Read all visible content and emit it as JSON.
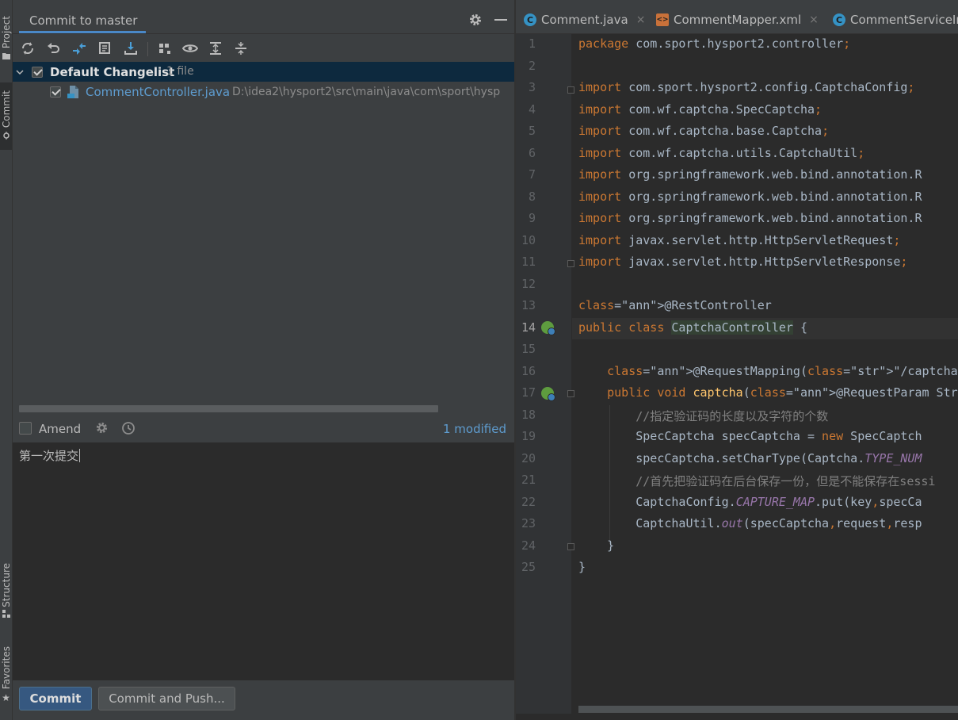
{
  "tool_strip": {
    "project_label": "Project",
    "commit_label": "Commit",
    "structure_label": "Structure",
    "favorites_label": "Favorites"
  },
  "panel": {
    "title": "Commit to master",
    "toolbar_icons": [
      "refresh-icon",
      "rollback-icon",
      "diff-icon",
      "show-history-icon",
      "update-icon",
      "group-by-icon",
      "eye-icon",
      "expand-all-icon",
      "collapse-all-icon"
    ],
    "changelist": {
      "name": "Default Changelist",
      "count": "1 file",
      "checked": true
    },
    "files": [
      {
        "name": "CommentController.java",
        "path": "D:\\idea2\\hysport2\\src\\main\\java\\com\\sport\\hysp",
        "checked": true
      }
    ],
    "amend_label": "Amend",
    "modified_label": "1 modified",
    "commit_message": "第一次提交",
    "commit_button": "Commit",
    "commit_push_button": "Commit and Push..."
  },
  "editor": {
    "tabs": [
      {
        "label": "Comment.java",
        "icon": "class-icon"
      },
      {
        "label": "CommentMapper.xml",
        "icon": "xml-icon"
      },
      {
        "label": "CommentServiceIr",
        "icon": "class-icon"
      }
    ],
    "current_line": 14,
    "lines": [
      "package com.sport.hysport2.controller;",
      "",
      "import com.sport.hysport2.config.CaptchaConfig;",
      "import com.wf.captcha.SpecCaptcha;",
      "import com.wf.captcha.base.Captcha;",
      "import com.wf.captcha.utils.CaptchaUtil;",
      "import org.springframework.web.bind.annotation.R",
      "import org.springframework.web.bind.annotation.R",
      "import org.springframework.web.bind.annotation.R",
      "import javax.servlet.http.HttpServletRequest;",
      "import javax.servlet.http.HttpServletResponse;",
      "",
      "@RestController",
      "public class CaptchaController {",
      "",
      "    @RequestMapping(\"/captcha\")",
      "    public void captcha(@RequestParam String key",
      "        //指定验证码的长度以及字符的个数",
      "        SpecCaptcha specCaptcha = new SpecCaptch",
      "        specCaptcha.setCharType(Captcha.TYPE_NUM",
      "        //首先把验证码在后台保存一份，但是不能保存在sessi",
      "        CaptchaConfig.CAPTURE_MAP.put(key,specCa",
      "        CaptchaUtil.out(specCaptcha,request,resp",
      "    }",
      "}"
    ],
    "line_numbers": [
      "1",
      "2",
      "3",
      "4",
      "5",
      "6",
      "7",
      "8",
      "9",
      "10",
      "11",
      "12",
      "13",
      "14",
      "15",
      "16",
      "17",
      "18",
      "19",
      "20",
      "21",
      "22",
      "23",
      "24",
      "25"
    ]
  },
  "colors": {
    "accent": "#4a88c7",
    "keyword": "#cc7832",
    "annotation": "#bbb529",
    "function": "#ffc66d",
    "string": "#6a8759",
    "comment": "#808080"
  }
}
